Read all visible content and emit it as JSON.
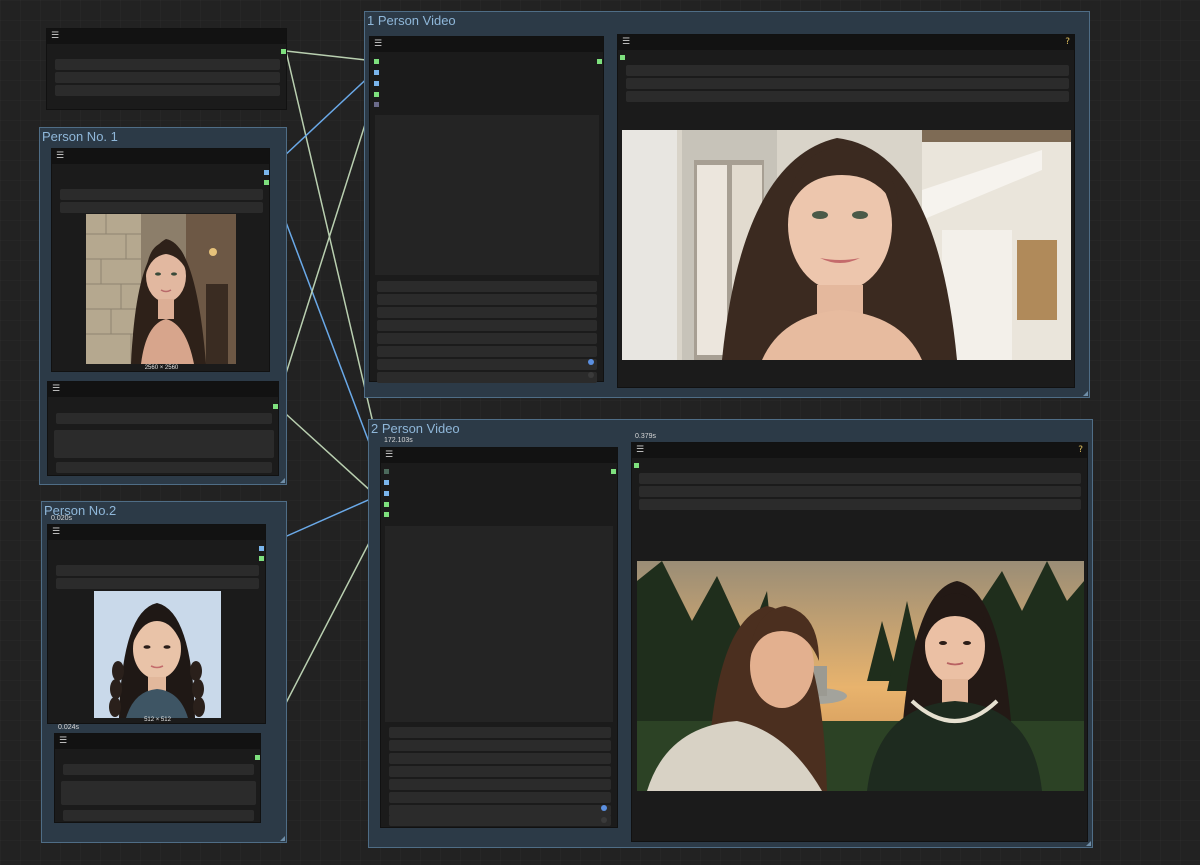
{
  "groups": {
    "person1": {
      "title": "Person No. 1"
    },
    "person2": {
      "title": "Person No.2"
    },
    "video1": {
      "title": "1 Person Video"
    },
    "video2": {
      "title": "2 Person Video"
    }
  },
  "image_captions": {
    "person1": "2560 × 2560",
    "person2": "512 × 512"
  },
  "timings": {
    "person2_loader": "0.020s",
    "person2_encoder": "0.024s",
    "video2_sampler": "172.103s",
    "video2_preview": "0.379s"
  },
  "icons": {
    "menu": "☰",
    "help": "?"
  },
  "colors": {
    "group_fill": "#2c3a47",
    "group_border": "#4f6d86",
    "node_fill": "#1b1b1b",
    "wire_green": "#b9cfb0",
    "wire_blue": "#6aa9e8"
  }
}
